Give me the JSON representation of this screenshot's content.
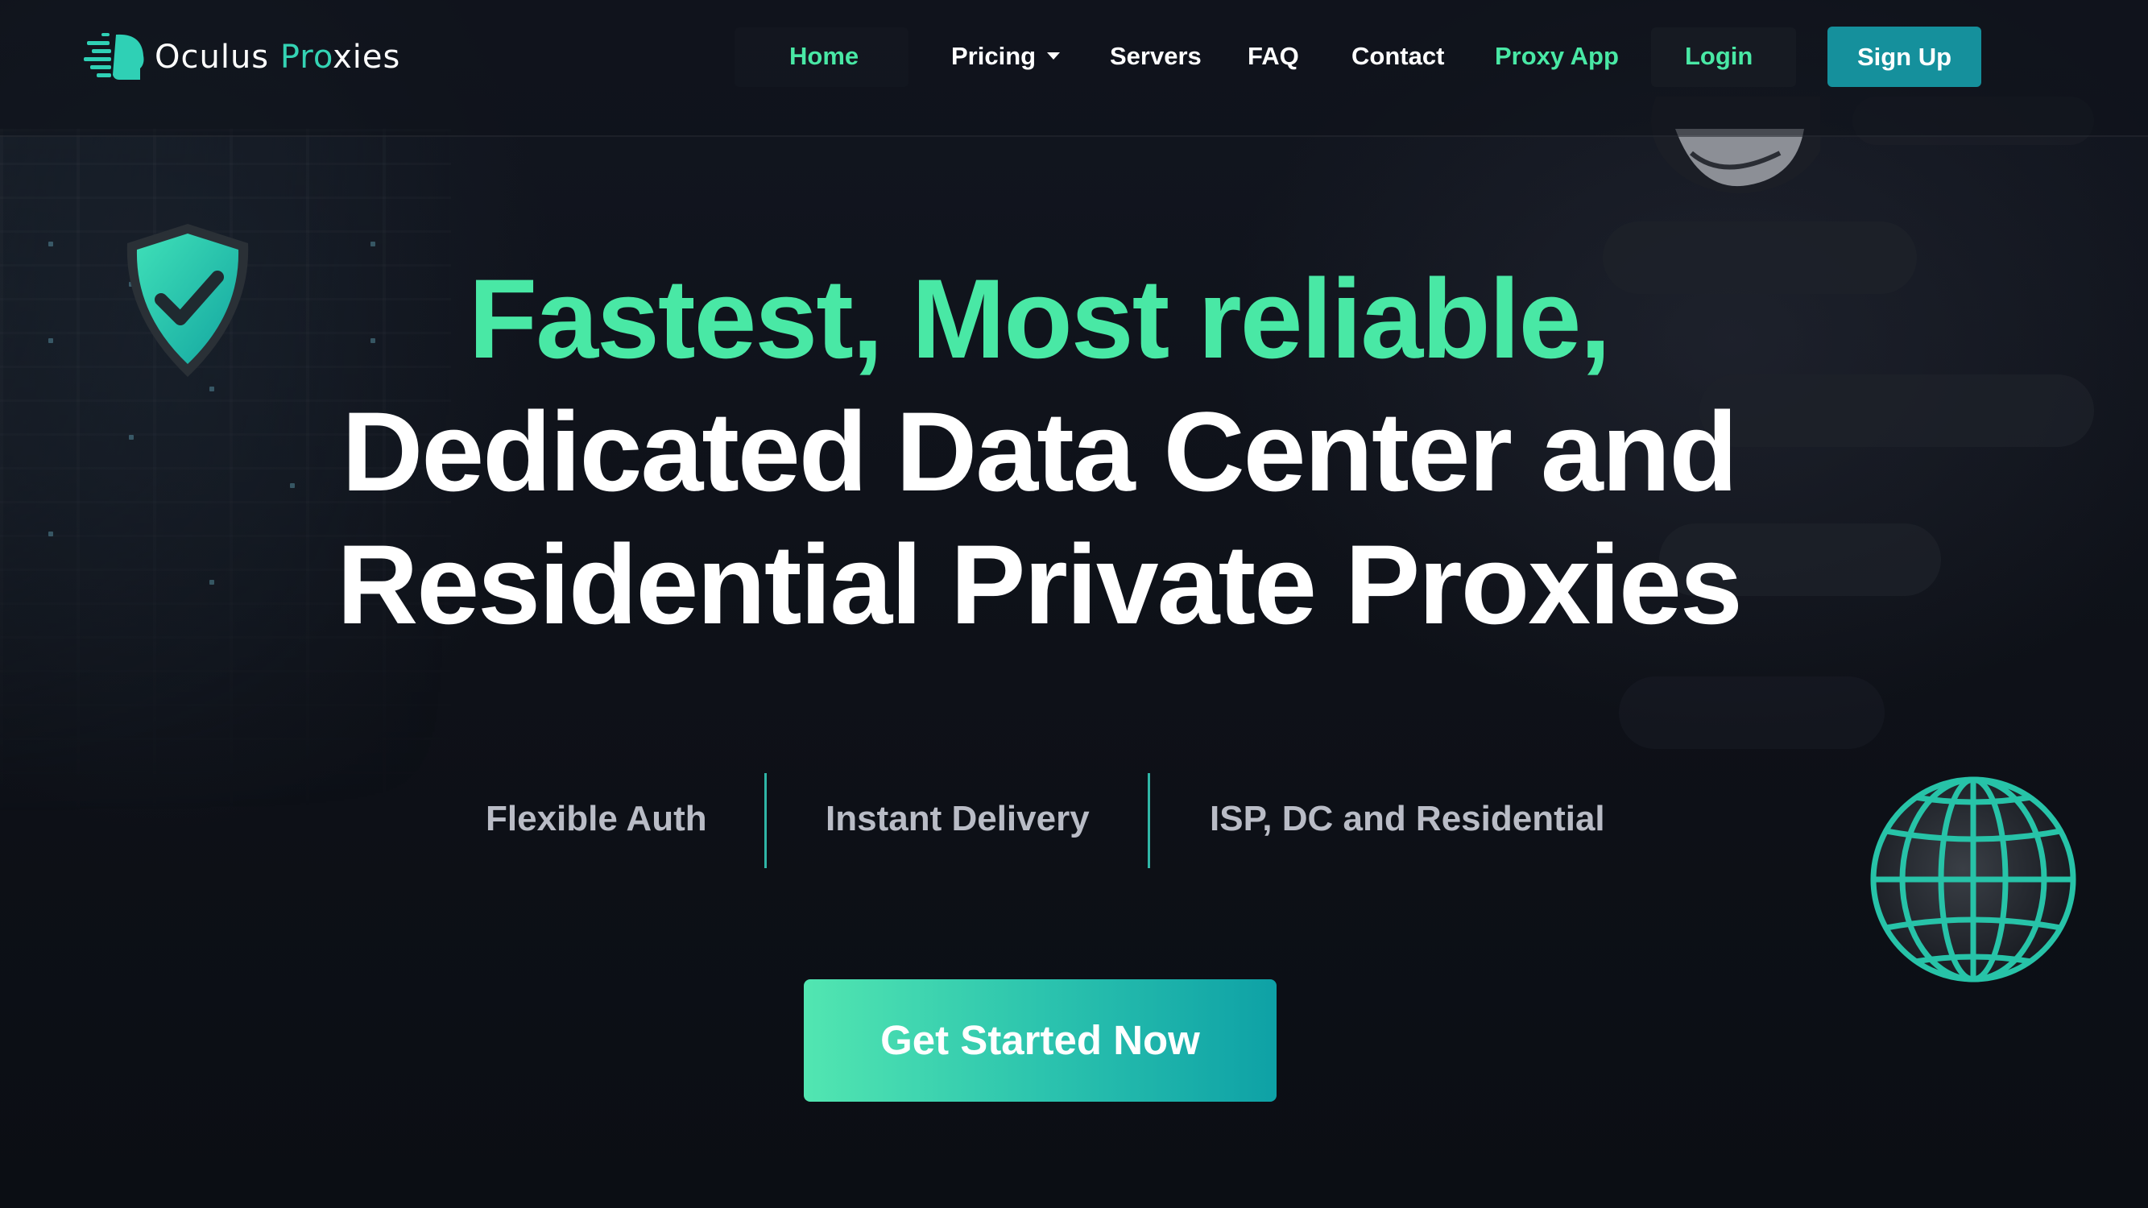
{
  "brand": {
    "name_part1": "Oculus ",
    "name_part2": "Pro",
    "name_part3": "xies",
    "accent_color": "#34d3b4",
    "logo_icon": "head-with-data-streaks-icon"
  },
  "nav": {
    "items": [
      {
        "label": "Home",
        "active": true
      },
      {
        "label": "Pricing",
        "has_dropdown": true
      },
      {
        "label": "Servers"
      },
      {
        "label": "FAQ"
      },
      {
        "label": "Contact"
      },
      {
        "label": "Proxy App",
        "highlight": true
      }
    ],
    "login_label": "Login",
    "signup_label": "Sign Up",
    "active_color": "#49e8a5",
    "signup_color": "#15909c"
  },
  "hero": {
    "line1": "Fastest, Most reliable,",
    "line2": "Dedicated Data Center and",
    "line3": "Residential Private Proxies",
    "line1_color": "#49e8a5"
  },
  "features": [
    "Flexible Auth",
    "Instant Delivery",
    "ISP, DC and Residential"
  ],
  "cta": {
    "label": "Get Started Now"
  },
  "decor": {
    "shield_icon": "shield-check-icon",
    "globe_icon": "wireframe-globe-icon",
    "mask_icon": "anonymous-mask-icon"
  }
}
